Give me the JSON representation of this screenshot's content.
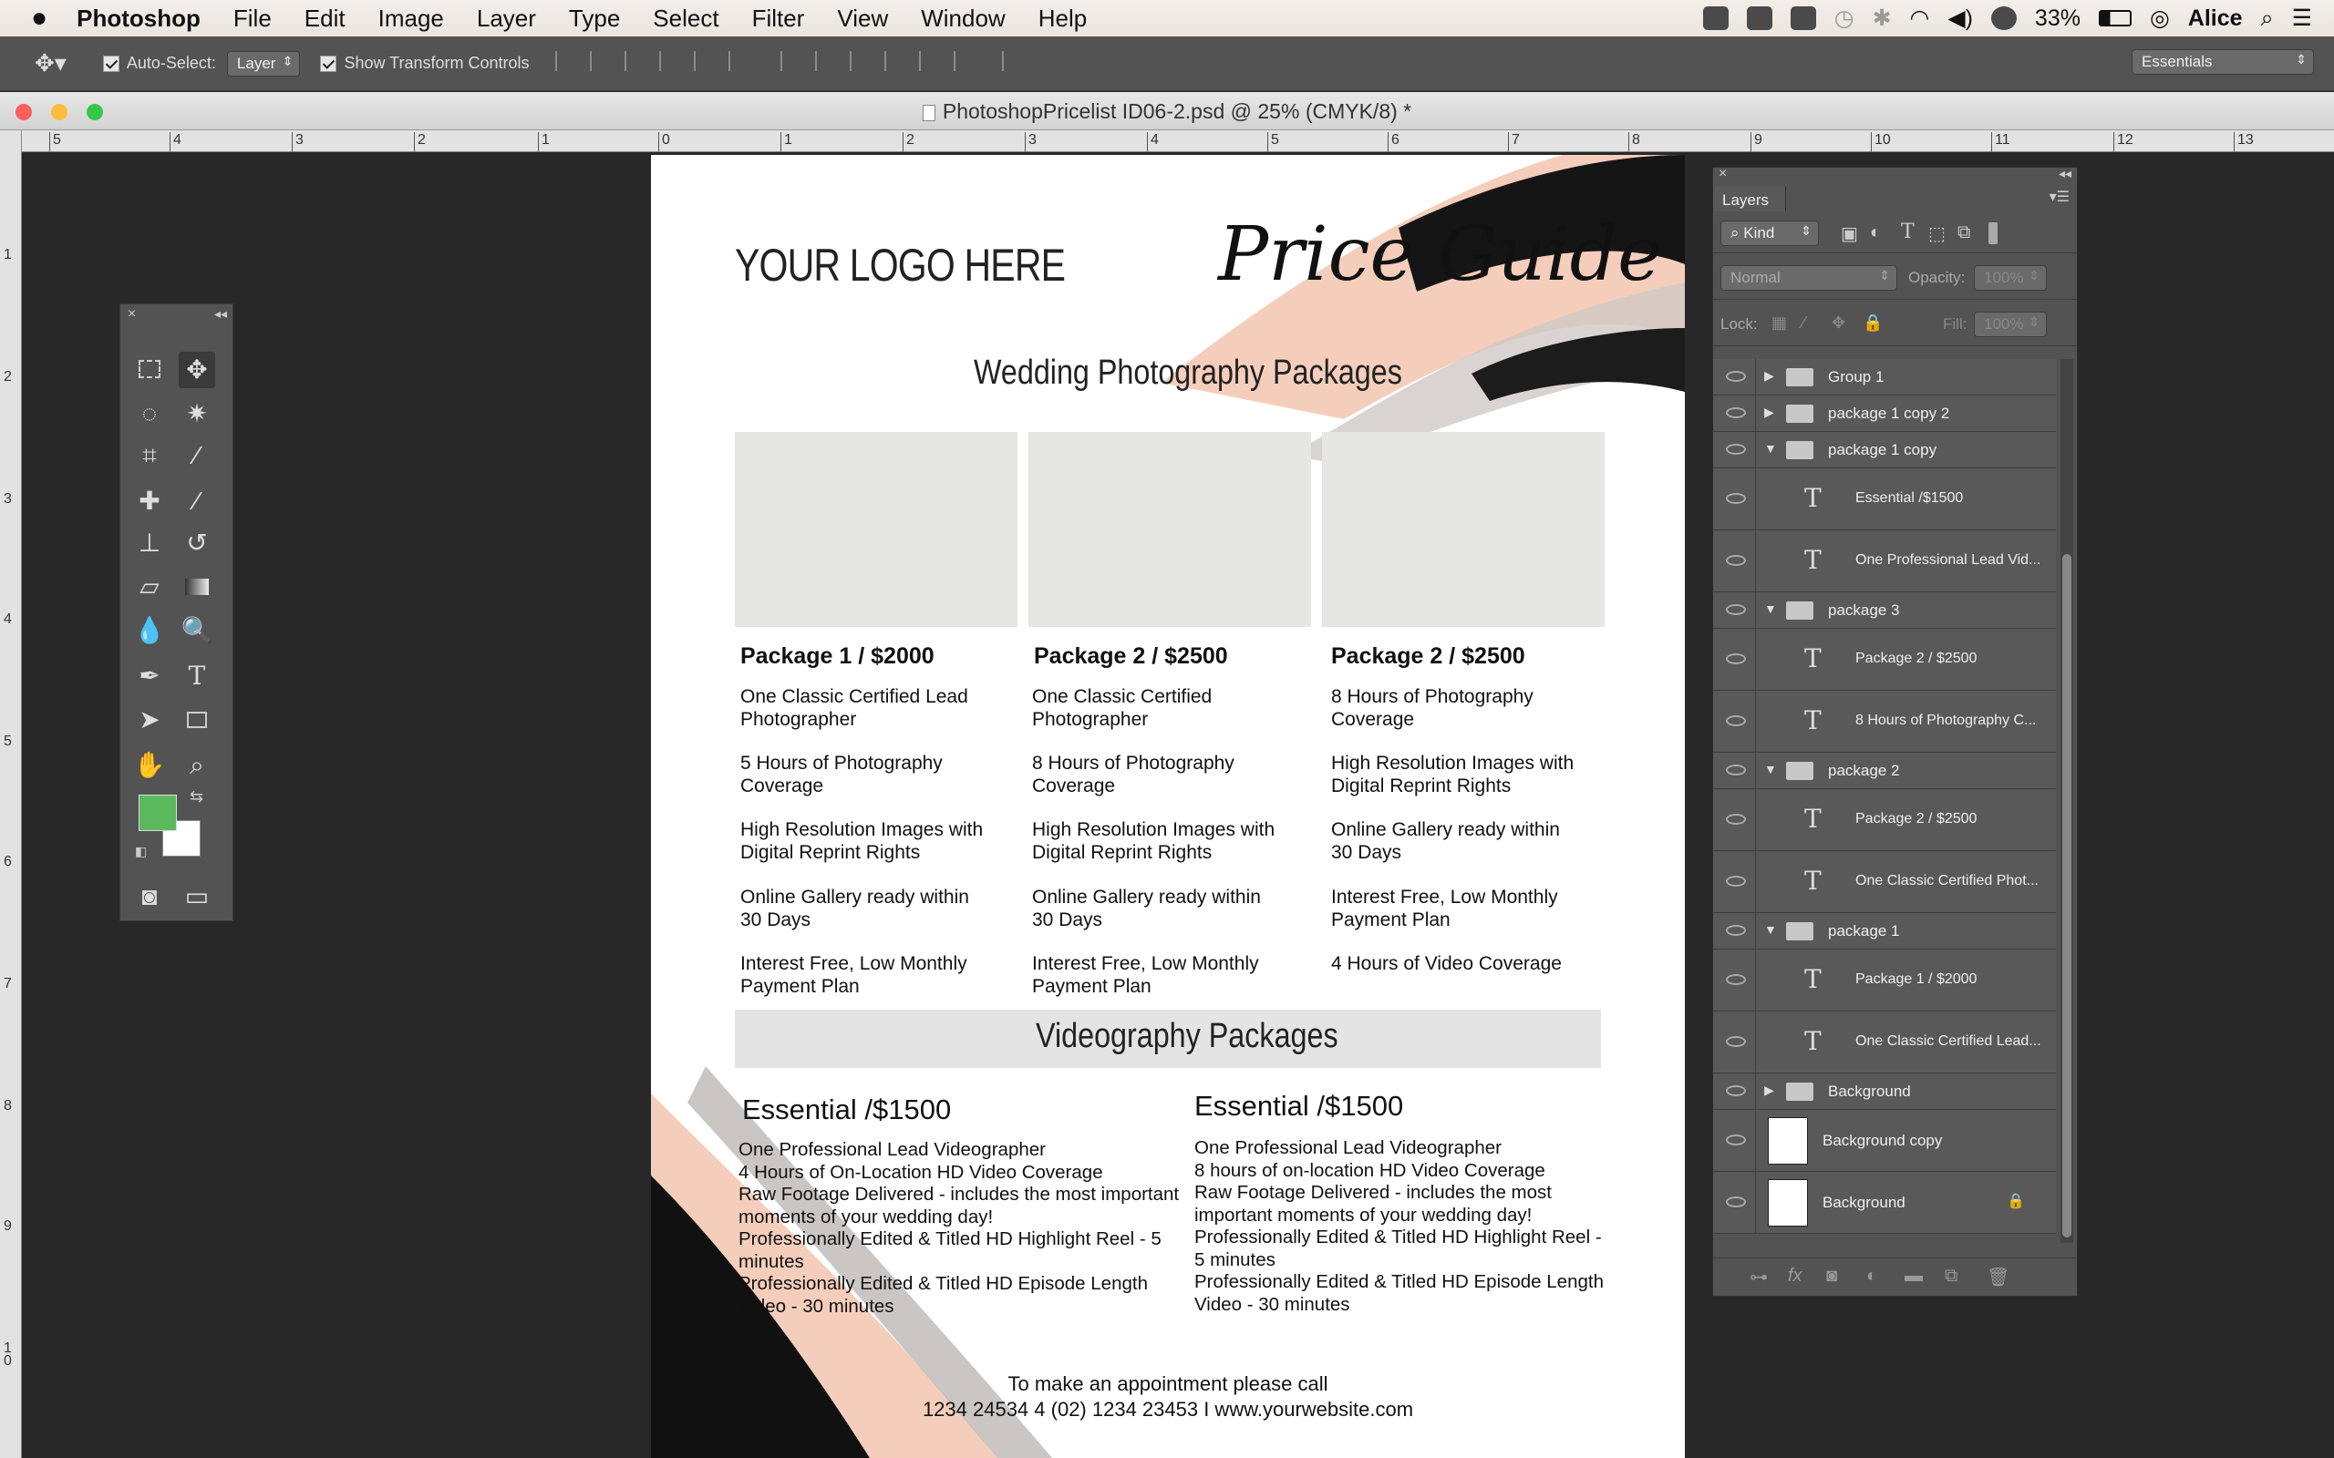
{
  "menubar": {
    "apple": "",
    "app": "Photoshop",
    "items": [
      "File",
      "Edit",
      "Image",
      "Layer",
      "Type",
      "Select",
      "Filter",
      "View",
      "Window",
      "Help"
    ],
    "battery": "33%",
    "user": "Alice"
  },
  "options": {
    "auto_select_label": "Auto-Select:",
    "auto_select_value": "Layer",
    "transform_label": "Show Transform Controls",
    "workspace": "Essentials"
  },
  "document": {
    "title": "PhotoshopPricelist ID06-2.psd @ 25% (CMYK/8) *",
    "logo": "YOUR LOGO HERE",
    "script_title": "Price Guide",
    "wedding_heading": "Wedding Photography Packages",
    "packages": [
      {
        "title": "Package 1 / $2000",
        "features": [
          "One Classic Certified Lead Photographer",
          "5 Hours of Photography Coverage",
          "High Resolution Images with Digital Reprint Rights",
          "Online Gallery ready within 30 Days",
          "Interest Free, Low Monthly Payment Plan"
        ]
      },
      {
        "title": "Package 2 / $2500",
        "features": [
          "One Classic Certified Photographer",
          "8 Hours of Photography Coverage",
          "High Resolution Images with Digital Reprint Rights",
          "Online Gallery ready within 30 Days",
          "Interest Free, Low Monthly Payment Plan"
        ]
      },
      {
        "title": "Package 2 / $2500",
        "features": [
          "8 Hours of Photography Coverage",
          "High Resolution Images with Digital Reprint Rights",
          "Online Gallery ready within 30 Days",
          "Interest Free, Low Monthly Payment Plan",
          "4 Hours of Video Coverage"
        ]
      }
    ],
    "video_heading": "Videography Packages",
    "video_packages": [
      {
        "title": "Essential /$1500",
        "lines": [
          "One Professional Lead Videographer",
          "4 Hours of On-Location HD Video Coverage",
          "Raw Footage Delivered - includes the most important",
          "moments of your wedding day!",
          "Professionally Edited & Titled HD Highlight Reel - 5",
          "minutes",
          "Professionally Edited & Titled HD Episode Length",
          "Video - 30 minutes"
        ]
      },
      {
        "title": "Essential /$1500",
        "lines": [
          "One Professional Lead Videographer",
          "8 hours of on-location HD Video Coverage",
          "Raw Footage Delivered - includes the most",
          "important moments of your wedding day!",
          "Professionally Edited & Titled HD Highlight Reel -",
          "5 minutes",
          "Professionally Edited & Titled HD Episode Length",
          "Video - 30 minutes"
        ]
      }
    ],
    "footer1": "To make an appointment please call",
    "footer2": "1234 24534 4 (02) 1234 23453 I www.yourwebsite.com"
  },
  "rulers": {
    "h": [
      "5",
      "4",
      "3",
      "2",
      "1",
      "0",
      "1",
      "2",
      "3",
      "4",
      "5",
      "6",
      "7",
      "8",
      "9",
      "10",
      "11",
      "12",
      "13"
    ],
    "v": [
      "1",
      "2",
      "3",
      "4",
      "5",
      "6",
      "7",
      "8",
      "9",
      "1 0"
    ]
  },
  "layers": {
    "tab": "Layers",
    "kind": "Kind",
    "blend": "Normal",
    "opacity_label": "Opacity:",
    "opacity": "100%",
    "lock_label": "Lock:",
    "fill_label": "Fill:",
    "fill": "100%",
    "rows": [
      {
        "type": "group",
        "name": "Group 1",
        "open": false
      },
      {
        "type": "group",
        "name": "package 1 copy 2",
        "open": false
      },
      {
        "type": "group",
        "name": "package 1 copy",
        "open": true
      },
      {
        "type": "text",
        "name": "Essential /$1500"
      },
      {
        "type": "text",
        "name": "One Professional Lead Vid..."
      },
      {
        "type": "group",
        "name": "package 3",
        "open": true
      },
      {
        "type": "text",
        "name": "Package 2 / $2500"
      },
      {
        "type": "text",
        "name": "8 Hours of Photography C..."
      },
      {
        "type": "group",
        "name": "package 2",
        "open": true
      },
      {
        "type": "text",
        "name": "Package 2 / $2500"
      },
      {
        "type": "text",
        "name": "One Classic Certified Phot..."
      },
      {
        "type": "group",
        "name": "package 1",
        "open": true
      },
      {
        "type": "text",
        "name": "Package 1 / $2000"
      },
      {
        "type": "text",
        "name": "One Classic Certified Lead..."
      },
      {
        "type": "group",
        "name": "Background",
        "open": false
      },
      {
        "type": "pixel",
        "name": "Background copy"
      },
      {
        "type": "pixel",
        "name": "Background",
        "locked": true
      }
    ]
  },
  "colors": {
    "foreground": "#5cb85c",
    "background": "#ffffff",
    "blush": "#f4c9b4"
  }
}
